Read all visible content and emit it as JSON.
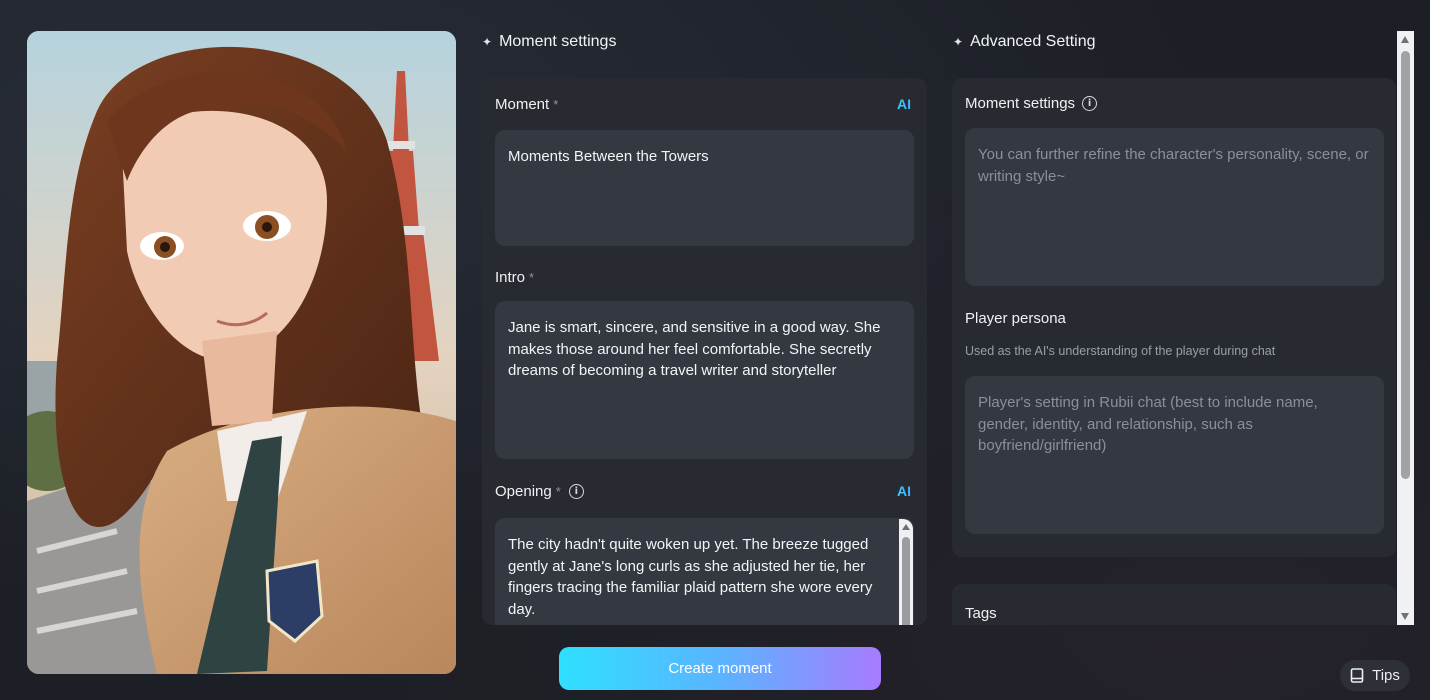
{
  "left": {
    "section_title": "Moment settings",
    "moment": {
      "label": "Moment",
      "required_mark": "*",
      "ai_label": "AI",
      "value": "Moments Between the Towers"
    },
    "intro": {
      "label": "Intro",
      "required_mark": "*",
      "value": "Jane is smart, sincere, and sensitive in a good way. She makes those around her feel comfortable. She secretly dreams of becoming a travel writer and storyteller"
    },
    "opening": {
      "label": "Opening",
      "required_mark": "*",
      "ai_label": "AI",
      "value": "The city hadn't quite woken up yet. The breeze tugged gently at Jane's long curls as she adjusted her tie, her fingers tracing the familiar plaid pattern she wore every day."
    }
  },
  "right": {
    "section_title": "Advanced Setting",
    "moment_settings": {
      "label": "Moment settings",
      "placeholder": "You can further refine the character's personality, scene, or writing style~"
    },
    "player_persona": {
      "label": "Player persona",
      "hint": "Used as the AI's understanding of the player during chat",
      "placeholder": "Player's setting in Rubii chat (best to include name, gender, identity, and relationship, such as boyfriend/girlfriend)"
    },
    "tags": {
      "label": "Tags"
    }
  },
  "actions": {
    "create_label": "Create moment",
    "tips_label": "Tips"
  },
  "icons": {
    "sparkle": "✦",
    "info": "i"
  },
  "colors": {
    "background": "#1c1f25",
    "panel": "#272a31",
    "input": "#343841",
    "ai_accent": "#2fd4ff",
    "button_gradient_start": "#2fe0ff",
    "button_gradient_end": "#a77bff"
  }
}
